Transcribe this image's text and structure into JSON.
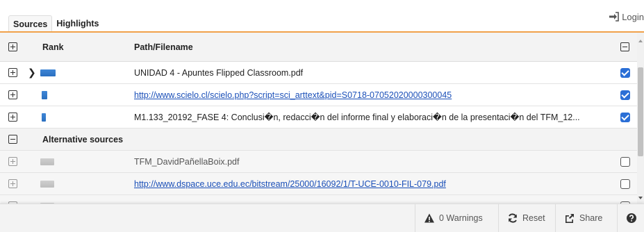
{
  "tabs": [
    {
      "label": "Sources",
      "active": true
    },
    {
      "label": "Highlights",
      "active": false
    }
  ],
  "login": {
    "label": "Login",
    "icon": "sign-in-icon"
  },
  "table": {
    "headers": {
      "rank": "Rank",
      "path": "Path/Filename"
    },
    "sources": [
      {
        "path": "UNIDAD 4 - Apuntes Flipped Classroom.pdf",
        "is_link": false,
        "checked": true
      },
      {
        "path": "http://www.scielo.cl/scielo.php?script=sci_arttext&pid=S0718-07052020000300045",
        "is_link": true,
        "checked": true
      },
      {
        "path": "M1.133_20192_FASE 4: Conclusi�n, redacci�n del informe final y elaboraci�n de la presentaci�n del TFM_12...",
        "is_link": false,
        "checked": true
      }
    ],
    "alt_group_label": "Alternative sources",
    "alternatives": [
      {
        "path": "TFM_DavidPañellaBoix.pdf",
        "is_link": false,
        "checked": false
      },
      {
        "path": "http://www.dspace.uce.edu.ec/bitstream/25000/16092/1/T-UCE-0010-FIL-079.pdf",
        "is_link": true,
        "checked": false
      }
    ]
  },
  "footer": {
    "warnings": "0 Warnings",
    "reset": "Reset",
    "share": "Share"
  },
  "colors": {
    "accent_line": "#f0a14a",
    "checkbox": "#2b6fd6",
    "link": "#1a4fb8",
    "rank_bar": "#2a6fc0"
  }
}
